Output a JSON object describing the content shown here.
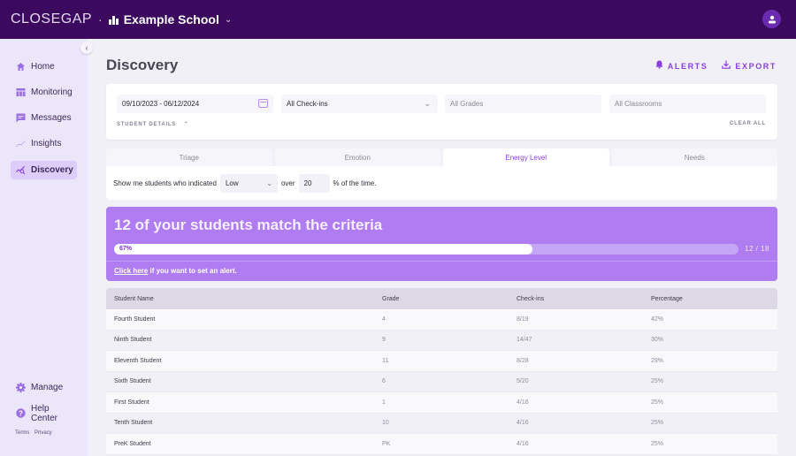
{
  "topbar": {
    "logo": "CLOSEGAP",
    "separator": "·",
    "school_name": "Example School"
  },
  "sidebar": {
    "items": [
      {
        "label": "Home",
        "icon": "home-icon"
      },
      {
        "label": "Monitoring",
        "icon": "monitoring-icon"
      },
      {
        "label": "Messages",
        "icon": "message-icon"
      },
      {
        "label": "Insights",
        "icon": "insights-icon"
      },
      {
        "label": "Discovery",
        "icon": "discovery-icon",
        "active": true
      }
    ],
    "bottom_items": [
      {
        "label": "Manage",
        "icon": "gear-icon"
      },
      {
        "label": "Help Center",
        "icon": "help-icon"
      }
    ],
    "footer_links": [
      "Terms",
      "Privacy"
    ]
  },
  "header": {
    "title": "Discovery",
    "alerts_label": "ALERTS",
    "export_label": "EXPORT"
  },
  "filters": {
    "date_range": "09/10/2023 - 06/12/2024",
    "checkins": "All Check-ins",
    "grades_placeholder": "All Grades",
    "classrooms_placeholder": "All Classrooms",
    "student_details_label": "STUDENT DETAILS",
    "clear_all_label": "CLEAR ALL"
  },
  "tabs": [
    {
      "label": "Triage"
    },
    {
      "label": "Emotion"
    },
    {
      "label": "Energy Level",
      "active": true
    },
    {
      "label": "Needs"
    }
  ],
  "criteria": {
    "prefix": "Show me students who indicated",
    "level": "Low",
    "middle": "over",
    "percent": "20",
    "suffix": "% of the time."
  },
  "match": {
    "title": "12 of your students match the criteria",
    "progress_percent": 67,
    "progress_label": "67%",
    "count_label": "12 / 18",
    "alert_link": "Click here",
    "alert_text": " if you want to set an alert."
  },
  "colors": {
    "accent": "#8a3ee0",
    "topbar": "#3b0a5f",
    "match_card": "#b07cf2"
  },
  "table": {
    "headers": [
      "Student Name",
      "Grade",
      "Check-ins",
      "Percentage"
    ],
    "rows": [
      [
        "Fourth Student",
        "4",
        "8/19",
        "42%"
      ],
      [
        "Ninth Student",
        "9",
        "14/47",
        "30%"
      ],
      [
        "Eleventh Student",
        "11",
        "8/28",
        "29%"
      ],
      [
        "Sixth Student",
        "6",
        "5/20",
        "25%"
      ],
      [
        "First Student",
        "1",
        "4/16",
        "25%"
      ],
      [
        "Tenth Student",
        "10",
        "4/16",
        "25%"
      ],
      [
        "PreK Student",
        "PK",
        "4/16",
        "25%"
      ]
    ]
  }
}
